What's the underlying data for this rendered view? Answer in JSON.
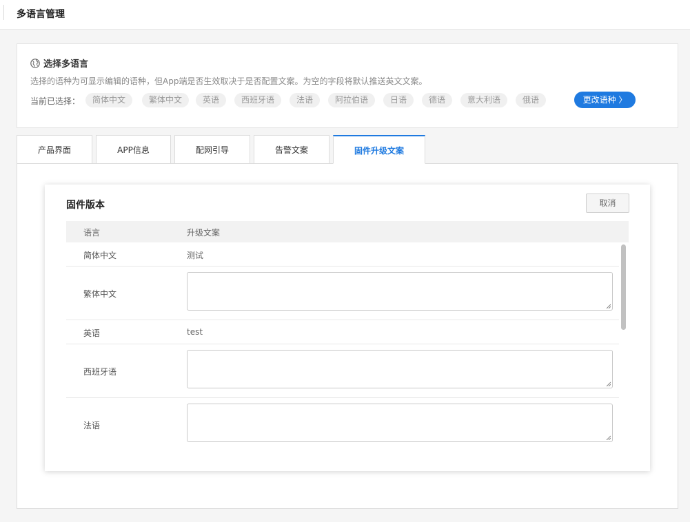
{
  "header": {
    "title": "多语言管理"
  },
  "language_card": {
    "title": "选择多语言",
    "description": "选择的语种为可显示编辑的语种，但App端是否生效取决于是否配置文案。为空的字段将默认推送英文文案。",
    "selected_label": "当前已选择：",
    "languages": [
      "简体中文",
      "繁体中文",
      "英语",
      "西班牙语",
      "法语",
      "阿拉伯语",
      "日语",
      "德语",
      "意大利语",
      "俄语"
    ],
    "change_button": "更改语种 〉"
  },
  "tabs": [
    "产品界面",
    "APP信息",
    "配网引导",
    "告警文案",
    "固件升级文案"
  ],
  "active_tab_index": 4,
  "modal": {
    "title": "固件版本",
    "cancel": "取消",
    "columns": [
      "语言",
      "升级文案"
    ],
    "rows": [
      {
        "language": "简体中文",
        "text": "测试"
      },
      {
        "language": "繁体中文",
        "text": ""
      },
      {
        "language": "英语",
        "text": "test"
      },
      {
        "language": "西班牙语",
        "text": ""
      },
      {
        "language": "法语",
        "text": ""
      }
    ]
  },
  "icons": {
    "language_icon": "globe-icon",
    "textarea_grip": "resize-grip-icon"
  },
  "colors": {
    "accent": "#1f7ae0",
    "chip_bg": "#f0f0f0"
  }
}
